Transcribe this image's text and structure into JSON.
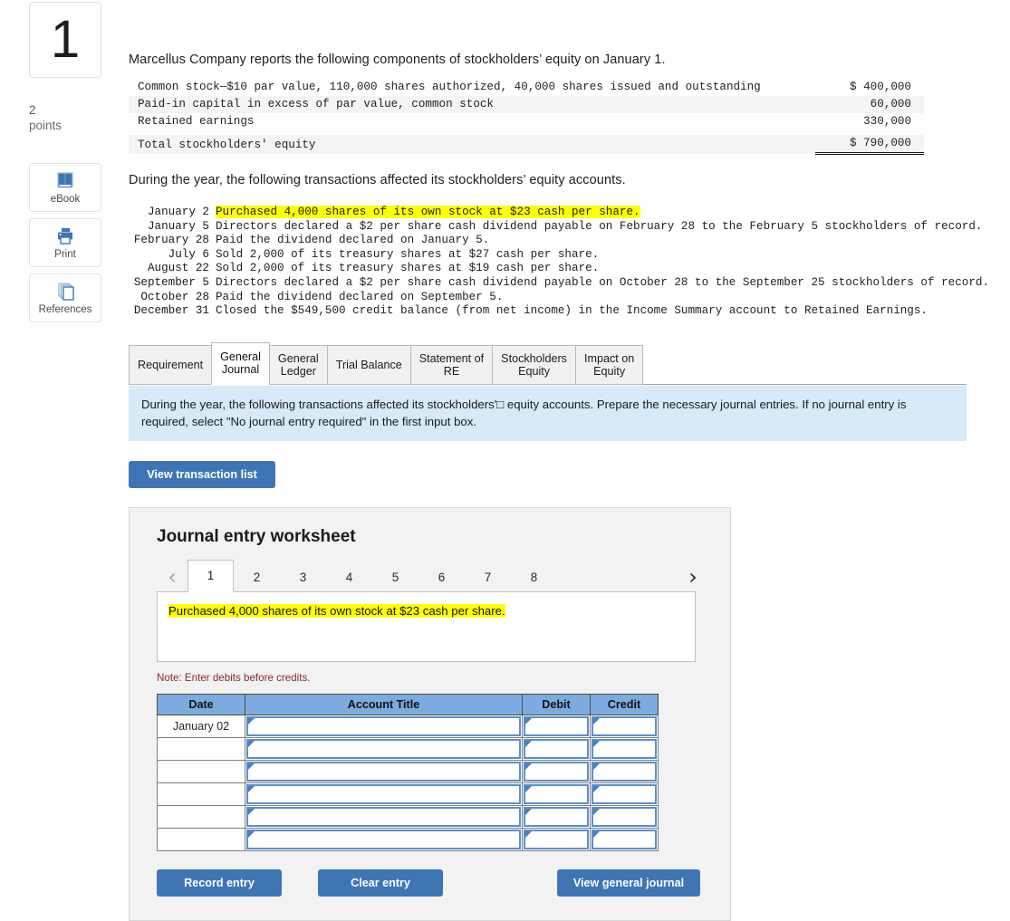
{
  "sidebar": {
    "question_number": "1",
    "points_value": "2",
    "points_label": "points",
    "buttons": [
      {
        "label": "eBook",
        "icon": "ebook-icon"
      },
      {
        "label": "Print",
        "icon": "printer-icon"
      },
      {
        "label": "References",
        "icon": "references-icon"
      }
    ]
  },
  "problem": {
    "intro": "Marcellus Company reports the following components of stockholders’ equity on January 1.",
    "equity_rows": [
      {
        "label": "Common stock—$10 par value, 110,000 shares authorized, 40,000 shares issued and outstanding",
        "amount": "$ 400,000"
      },
      {
        "label": "Paid-in capital in excess of par value, common stock",
        "amount": "60,000"
      },
      {
        "label": "Retained earnings",
        "amount": "330,000"
      }
    ],
    "equity_total": {
      "label": "Total stockholders' equity",
      "amount": "$ 790,000"
    },
    "transactions_intro": "During the year, the following transactions affected its stockholders’ equity accounts.",
    "transactions": [
      {
        "date": "January 2",
        "text": "Purchased 4,000 shares of its own stock at $23 cash per share.",
        "highlighted": true
      },
      {
        "date": "January 5",
        "text": "Directors declared a $2 per share cash dividend payable on February 28 to the February 5 stockholders of record.",
        "highlighted": false
      },
      {
        "date": "February 28",
        "text": "Paid the dividend declared on January 5.",
        "highlighted": false
      },
      {
        "date": "July 6",
        "text": "Sold 2,000 of its treasury shares at $27 cash per share.",
        "highlighted": false
      },
      {
        "date": "August 22",
        "text": "Sold 2,000 of its treasury shares at $19 cash per share.",
        "highlighted": false
      },
      {
        "date": "September 5",
        "text": "Directors declared a $2 per share cash dividend payable on October 28 to the September 25 stockholders of record.",
        "highlighted": false
      },
      {
        "date": "October 28",
        "text": "Paid the dividend declared on September 5.",
        "highlighted": false
      },
      {
        "date": "December 31",
        "text": "Closed the $549,500 credit balance (from net income) in the Income Summary account to Retained Earnings.",
        "highlighted": false
      }
    ]
  },
  "tabs": [
    {
      "label": "Requirement",
      "active": false
    },
    {
      "label": "General\nJournal",
      "active": true
    },
    {
      "label": "General\nLedger",
      "active": false
    },
    {
      "label": "Trial Balance",
      "active": false
    },
    {
      "label": "Statement of\nRE",
      "active": false
    },
    {
      "label": "Stockholders\nEquity",
      "active": false
    },
    {
      "label": "Impact on\nEquity",
      "active": false
    }
  ],
  "instruction": "During the year, the following transactions affected its stockholders'□ equity accounts.  Prepare the necessary journal entries.  If no journal entry is required, select \"No journal entry required\" in the first input box.",
  "view_transaction_list_label": "View transaction list",
  "worksheet": {
    "title": "Journal entry worksheet",
    "prev_arrow": "‹",
    "next_arrow": "›",
    "pages": [
      "1",
      "2",
      "3",
      "4",
      "5",
      "6",
      "7",
      "8"
    ],
    "active_page": "1",
    "transaction_text": "Purchased 4,000 shares of its own stock at $23 cash per share.",
    "note": "Note: Enter debits before credits.",
    "table_headers": [
      "Date",
      "Account Title",
      "Debit",
      "Credit"
    ],
    "rows": [
      {
        "date": "January 02",
        "account": "",
        "debit": "",
        "credit": ""
      },
      {
        "date": "",
        "account": "",
        "debit": "",
        "credit": ""
      },
      {
        "date": "",
        "account": "",
        "debit": "",
        "credit": ""
      },
      {
        "date": "",
        "account": "",
        "debit": "",
        "credit": ""
      },
      {
        "date": "",
        "account": "",
        "debit": "",
        "credit": ""
      },
      {
        "date": "",
        "account": "",
        "debit": "",
        "credit": ""
      }
    ],
    "buttons": {
      "record": "Record entry",
      "clear": "Clear entry",
      "view_journal": "View general journal"
    }
  },
  "colors": {
    "accent_blue": "#3e76b5",
    "header_blue": "#7cacdf",
    "instruction_bg": "#d6eaf8",
    "highlight_yellow": "#ffff00",
    "note_red": "#8b2a2a"
  }
}
